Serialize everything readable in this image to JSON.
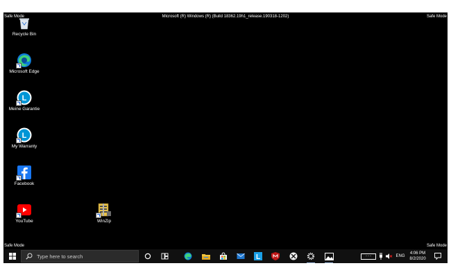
{
  "screen": {
    "safe_mode_label": "Safe Mode",
    "build_info": "Microsoft (R) Windows (R) (Build 18362.19h1_release.190318-1202)"
  },
  "desktop": {
    "icons": [
      {
        "label": "Recycle Bin",
        "icon": "recycle-bin-icon"
      },
      {
        "label": "Microsoft Edge",
        "icon": "edge-icon"
      },
      {
        "label": "Meine Garantie",
        "icon": "warranty-icon"
      },
      {
        "label": "My Warranty",
        "icon": "warranty-icon"
      },
      {
        "label": "Facebook",
        "icon": "facebook-icon"
      },
      {
        "label": "YouTube",
        "icon": "youtube-icon"
      },
      {
        "label": "WinZip",
        "icon": "winzip-icon"
      }
    ]
  },
  "taskbar": {
    "search_placeholder": "Type here to search",
    "pinned": [
      "cortana-icon",
      "task-view-icon",
      "edge-icon",
      "file-explorer-icon",
      "store-icon",
      "mail-icon",
      "l-app-icon",
      "mcafee-icon",
      "xbox-icon",
      "settings-icon",
      "photos-icon"
    ],
    "tray": {
      "keyboard_text": "- - -",
      "language": "ENG",
      "time": "4:06 PM",
      "date": "8/2/2020"
    }
  },
  "colors": {
    "screen_bg": "#000000",
    "taskbar_bg": "#101010",
    "edge_blue": "#0f7cd6",
    "facebook_blue": "#1877f2",
    "youtube_red": "#ff0000",
    "mcafee_red": "#c01818"
  }
}
